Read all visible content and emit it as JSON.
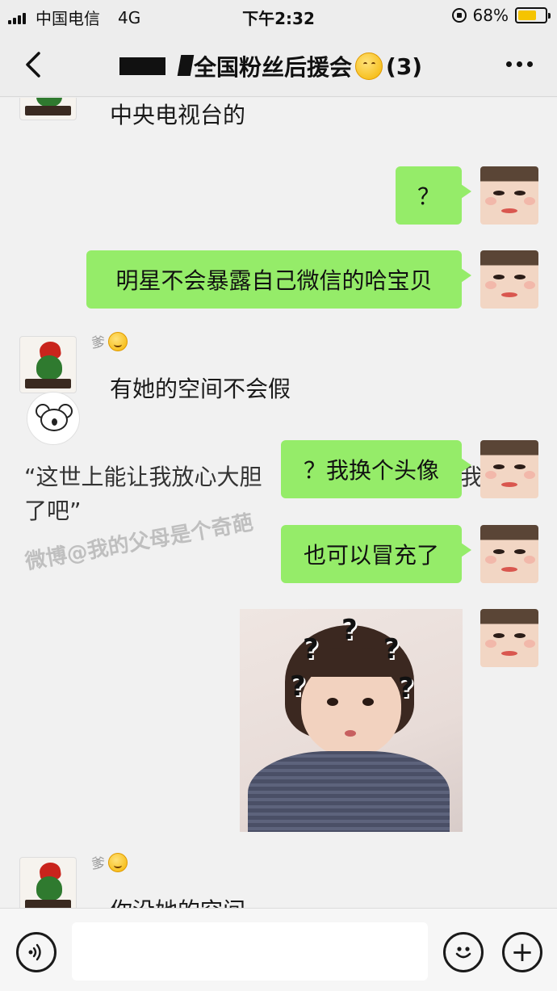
{
  "status_bar": {
    "carrier": "中国电信",
    "network": "4G",
    "time": "下午2:32",
    "battery_percent": "68%",
    "battery_level": 0.68,
    "icons": [
      "signal-icon",
      "rotation-lock-icon",
      "battery-icon"
    ]
  },
  "nav": {
    "back_icon": "chevron-left-icon",
    "title": "全国粉丝后援会",
    "title_emoji": "hugging-face-emoji",
    "member_count": "(3)",
    "more_icon": "more-dots-icon"
  },
  "messages": [
    {
      "side": "left",
      "text": "中央电视台的"
    },
    {
      "side": "right",
      "text": "？"
    },
    {
      "side": "right",
      "text": "明星不会暴露自己微信的哈宝贝"
    },
    {
      "side": "left",
      "sender": "爹",
      "text": "有她的空间不会假"
    },
    {
      "side": "right",
      "text": "？我换个头像"
    },
    {
      "side": "right",
      "text": "也可以冒充了"
    },
    {
      "side": "right",
      "type": "sticker",
      "sticker_marks": [
        "?",
        "?",
        "?",
        "?",
        "?"
      ]
    },
    {
      "side": "left",
      "sender": "爹",
      "text": "你没她的空间"
    }
  ],
  "overlay": {
    "quote_line1": "“这世上能让我放心大胆",
    "quote_tail1": "我",
    "quote_line2": "了吧”",
    "watermark": "微博@我的父母是个奇葩"
  },
  "input_bar": {
    "voice_icon": "voice-icon",
    "emoji_icon": "emoji-icon",
    "plus_icon": "plus-icon",
    "plus_glyph": "+",
    "placeholder": ""
  },
  "colors": {
    "bubble_green": "#95ec69",
    "background": "#ededed",
    "battery_fill": "#f5c400"
  }
}
